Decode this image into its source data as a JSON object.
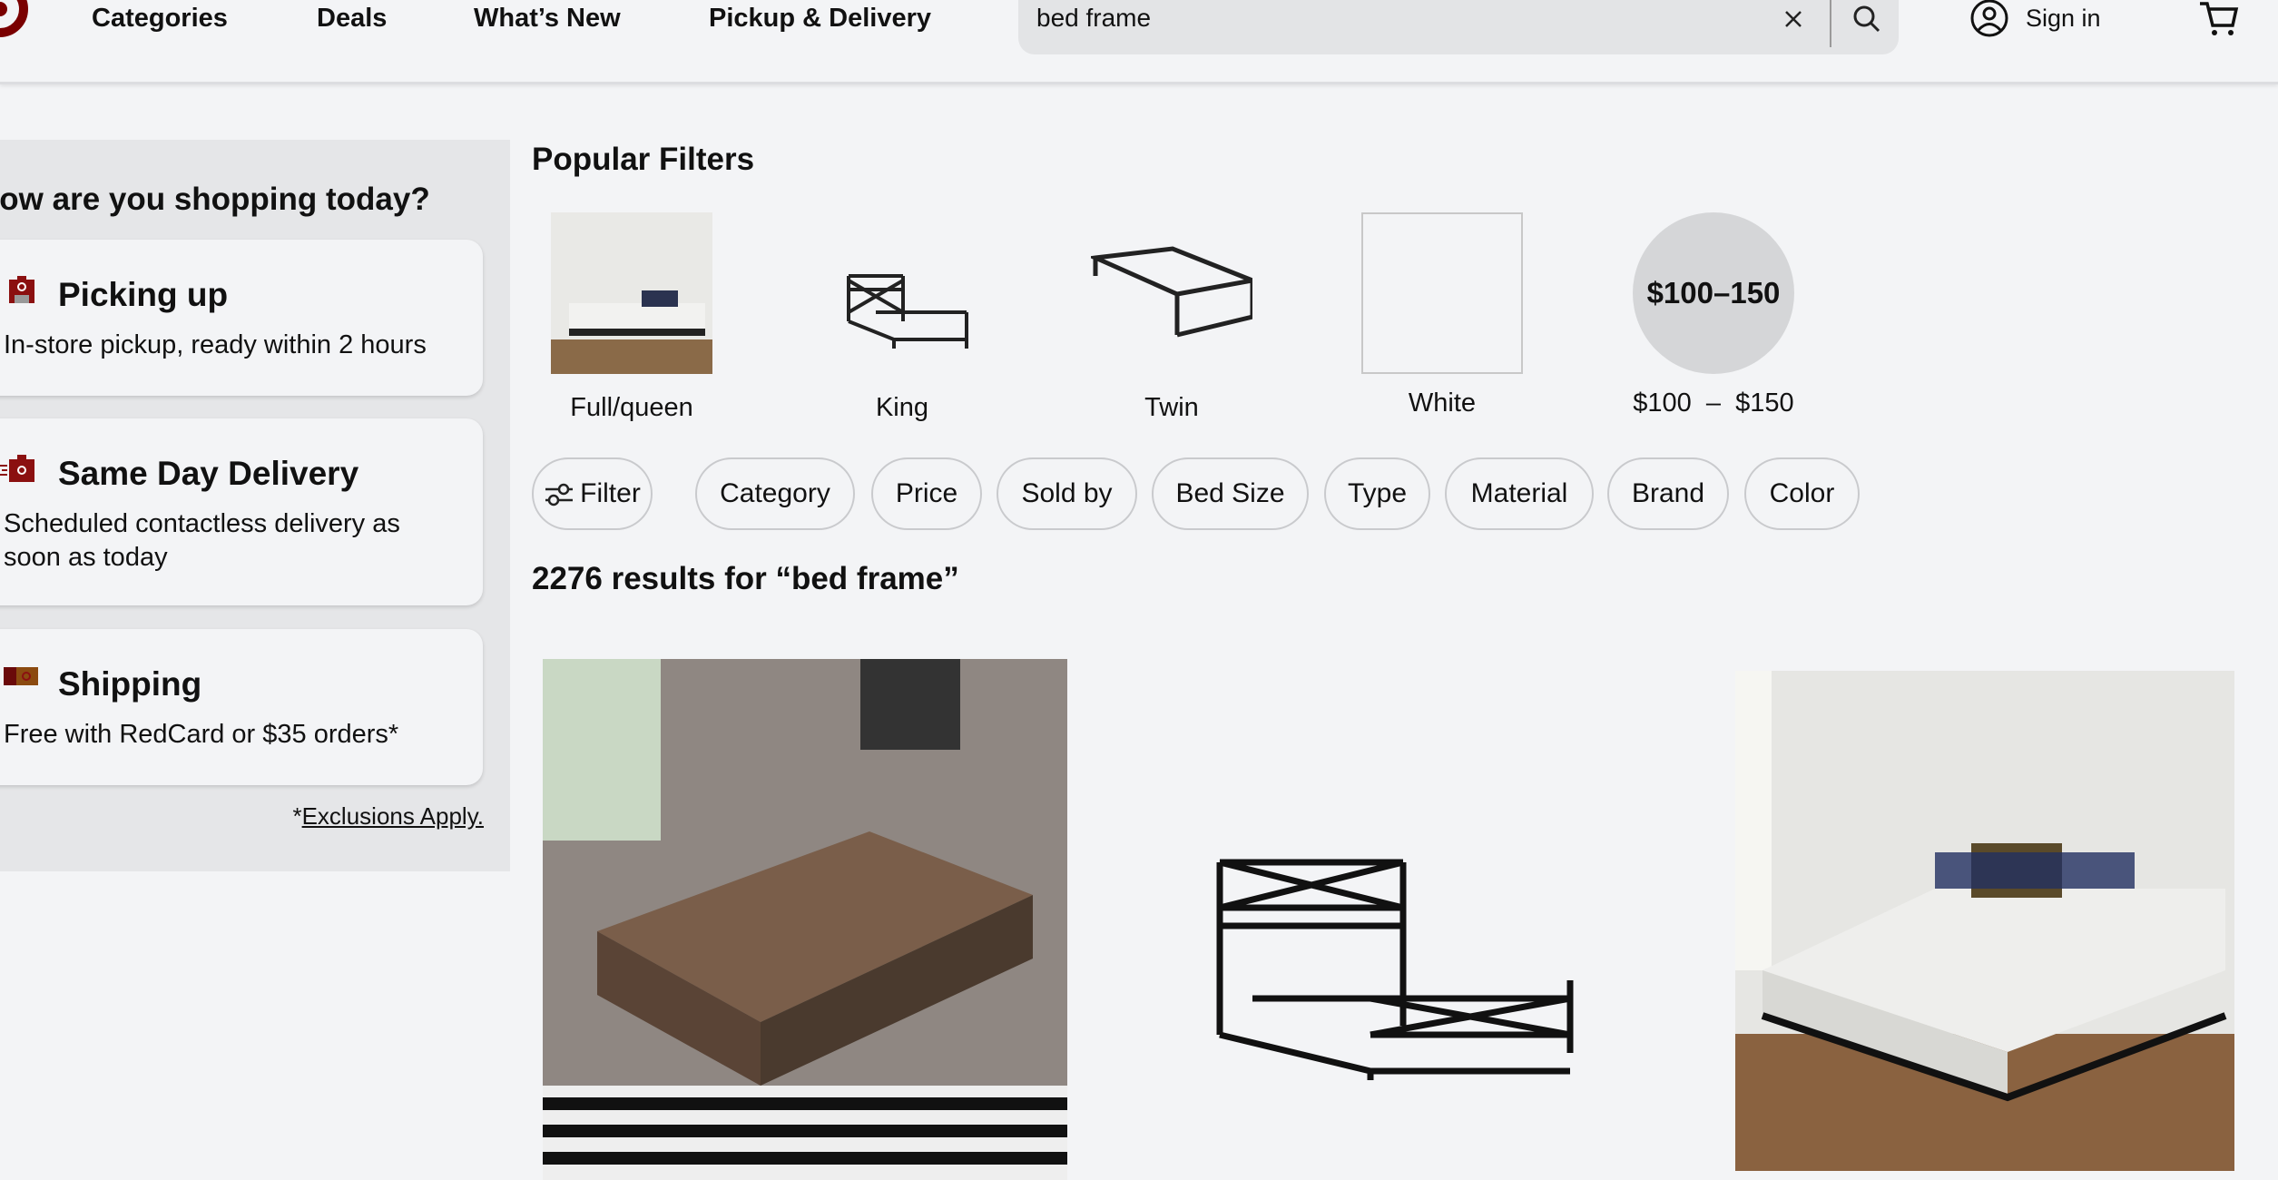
{
  "header": {
    "nav": [
      "Categories",
      "Deals",
      "What’s New",
      "Pickup & Delivery"
    ],
    "search_value": "bed frame",
    "sign_in": "Sign in",
    "brand_color": "#7a0000"
  },
  "sidebar": {
    "heading": "How are you shopping today?",
    "cards": [
      {
        "title": "Picking up",
        "desc": "In-store pickup, ready within 2 hours",
        "icon": "store-icon"
      },
      {
        "title": "Same Day Delivery",
        "desc": "Scheduled contactless delivery as soon as today",
        "icon": "delivery-bag-icon"
      },
      {
        "title": "Shipping",
        "desc": "Free with RedCard or $35 orders*",
        "icon": "shipping-box-icon"
      }
    ],
    "exclusions_prefix": "*",
    "exclusions_link": "Exclusions Apply."
  },
  "popular_filters": {
    "title": "Popular Filters",
    "items": [
      {
        "label": "Full/queen"
      },
      {
        "label": "King"
      },
      {
        "label": "Twin"
      },
      {
        "label": "White"
      },
      {
        "label": "$100  –  $150",
        "badge": "$100–150"
      }
    ]
  },
  "chips": [
    "Filter",
    "Category",
    "Price",
    "Sold by",
    "Bed Size",
    "Type",
    "Material",
    "Brand",
    "Color"
  ],
  "results": {
    "heading": "2276 results for “bed frame”"
  }
}
